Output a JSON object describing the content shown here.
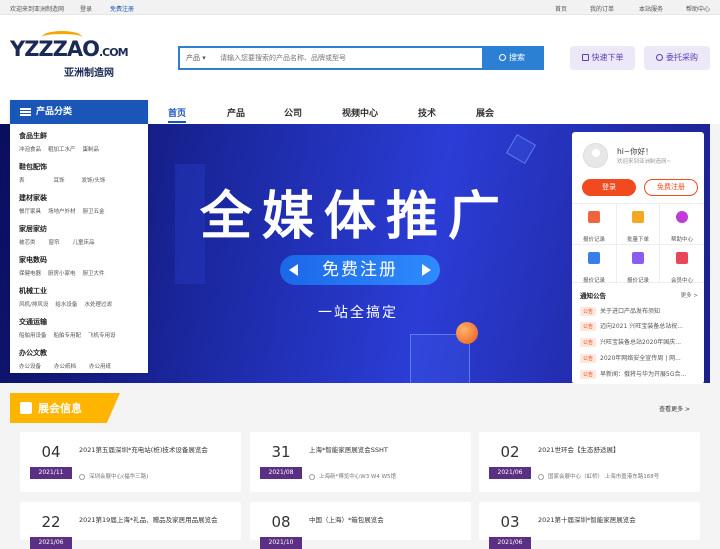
{
  "topbar": {
    "welcome": "欢迎来到亚洲制造网",
    "login": "登录",
    "register": "免费注册",
    "home": "首页",
    "orders": "我的订单",
    "service": "本站服务",
    "help": "帮助中心"
  },
  "logo": {
    "main": "YZZZAO",
    "com": ".COM",
    "sub": "亚洲制造网"
  },
  "search": {
    "category": "产品 ▾",
    "placeholder": "请输入您要搜索的产品名称、品牌或型号",
    "button": "搜索"
  },
  "header_buttons": {
    "quick_order": "快速下单",
    "entrust": "委托采购"
  },
  "nav": {
    "category_title": "产品分类",
    "items": [
      "首页",
      "产品",
      "公司",
      "视频中心",
      "技术",
      "展会"
    ]
  },
  "categories": [
    {
      "title": "食品生鲜",
      "subs": [
        "冲泡食品",
        "粗加工水产",
        "蛋制品"
      ]
    },
    {
      "title": "鞋包配饰",
      "subs": [
        "表",
        "耳饰",
        "发饰/头饰"
      ]
    },
    {
      "title": "建材家装",
      "subs": [
        "餐厅家具",
        "场地户外材",
        "厨卫五金"
      ]
    },
    {
      "title": "家居家纺",
      "subs": [
        "被芯类",
        "窗帘",
        "儿童床品"
      ]
    },
    {
      "title": "家电数码",
      "subs": [
        "保健电器",
        "厨房小家电",
        "厨卫大件"
      ]
    },
    {
      "title": "机械工业",
      "subs": [
        "风机/排风设",
        "给水设备",
        "水处理过滤"
      ]
    },
    {
      "title": "交通运输",
      "subs": [
        "船舶用设备",
        "船舶专用配",
        "飞机专用设"
      ]
    },
    {
      "title": "办公文教",
      "subs": [
        "办公设备",
        "办公纸档",
        "办公用纸"
      ]
    }
  ],
  "banner": {
    "title": "全媒体推广",
    "register": "免费注册",
    "subtitle": "一站全搞定"
  },
  "sidebar": {
    "greeting": "hi~你好！",
    "welcome": "欢迎来到亚洲制造网~",
    "login": "登录",
    "register": "免费注册",
    "quick_links": [
      {
        "label": "报价记录",
        "color": "#f0643c"
      },
      {
        "label": "批量下单",
        "color": "#f5a623"
      },
      {
        "label": "帮助中心",
        "color": "#c03bd8"
      },
      {
        "label": "报价记录",
        "color": "#3a7ee8"
      },
      {
        "label": "报价记录",
        "color": "#8a5cf0"
      },
      {
        "label": "会员中心",
        "color": "#e8465a"
      }
    ],
    "notice_title": "通知公告",
    "notice_more": "更多 >",
    "notice_tag": "公告",
    "notices": [
      "关于进口产品发布须知",
      "迈向2021 兴旺宝装备总站祝...",
      "兴旺宝装备总站2020年国庆...",
      "2020年网络安全宣传周 | 网...",
      "早新闻：俄将与华为开展5G合..."
    ]
  },
  "expo": {
    "title": "展会信息",
    "more": "查看更多 >",
    "cards": [
      {
        "day": "04",
        "month": "2021/11",
        "title": "2021第五届深圳*充电站(桩)技术设备展览会",
        "location": "深圳会展中心(福华三路)"
      },
      {
        "day": "31",
        "month": "2021/08",
        "title": "上海*智能家居展览会SSHT",
        "location": "上海新*博览中心W3 W4 W5馆"
      },
      {
        "day": "02",
        "month": "2021/06",
        "title": "2021世环会【生态舒适展】",
        "location": "国家会展中心（虹桥） 上海市盈港东路168号"
      },
      {
        "day": "22",
        "month": "2021/06",
        "title": "2021第19届上海*礼品、赠品及家居用品展览会",
        "location": ""
      },
      {
        "day": "08",
        "month": "2021/10",
        "title": "中国（上海）*箱包展览会",
        "location": ""
      },
      {
        "day": "03",
        "month": "2021/06",
        "title": "2021第十届深圳*智能家居展览会",
        "location": ""
      }
    ]
  }
}
